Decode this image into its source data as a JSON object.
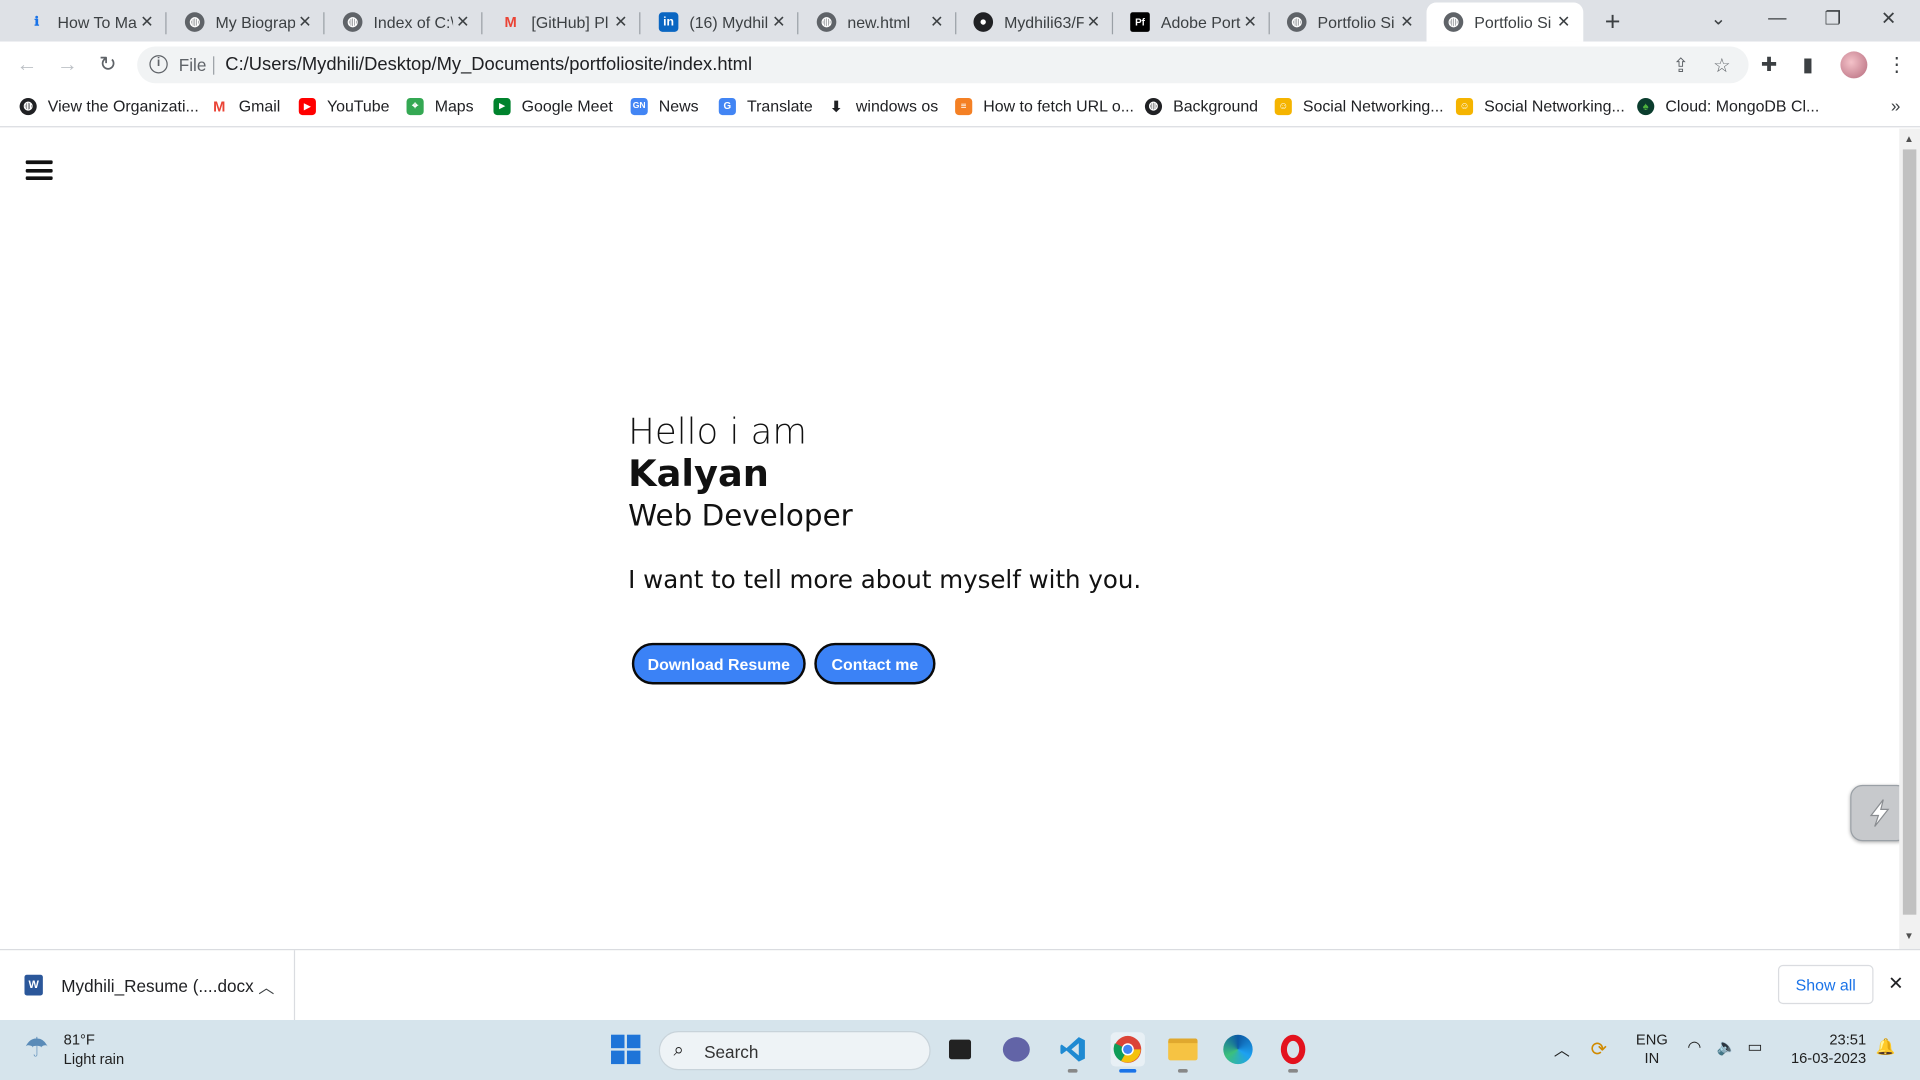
{
  "browser": {
    "tabs": [
      {
        "title": "How To Ma",
        "favicon": "info-icon",
        "active": false
      },
      {
        "title": "My Biograp",
        "favicon": "globe-icon",
        "active": false
      },
      {
        "title": "Index of C:\\",
        "favicon": "globe-icon",
        "active": false
      },
      {
        "title": "[GitHub] Pl",
        "favicon": "gmail-icon",
        "active": false
      },
      {
        "title": "(16) Mydhil",
        "favicon": "linkedin-icon",
        "active": false
      },
      {
        "title": "new.html",
        "favicon": "globe-icon",
        "active": false
      },
      {
        "title": "Mydhili63/F",
        "favicon": "github-icon",
        "active": false
      },
      {
        "title": "Adobe Port",
        "favicon": "adobe-portfolio-icon",
        "active": false
      },
      {
        "title": "Portfolio Si",
        "favicon": "globe-icon",
        "active": false
      },
      {
        "title": "Portfolio Si",
        "favicon": "globe-icon",
        "active": true
      }
    ],
    "address": {
      "scheme_label": "File",
      "url": "C:/Users/Mydhili/Desktop/My_Documents/portfoliosite/index.html"
    },
    "bookmarks": [
      {
        "label": "View the Organizati...",
        "icon": "globe-icon"
      },
      {
        "label": "Gmail",
        "icon": "gmail-icon"
      },
      {
        "label": "YouTube",
        "icon": "youtube-icon"
      },
      {
        "label": "Maps",
        "icon": "maps-icon"
      },
      {
        "label": "Google Meet",
        "icon": "meet-icon"
      },
      {
        "label": "News",
        "icon": "news-icon"
      },
      {
        "label": "Translate",
        "icon": "translate-icon"
      },
      {
        "label": "windows os",
        "icon": "download-icon"
      },
      {
        "label": "How to fetch URL o...",
        "icon": "stackoverflow-icon"
      },
      {
        "label": "Background",
        "icon": "globe-icon"
      },
      {
        "label": "Social Networking...",
        "icon": "social-icon"
      },
      {
        "label": "Social Networking...",
        "icon": "social-icon"
      },
      {
        "label": "Cloud: MongoDB Cl...",
        "icon": "mongodb-icon"
      }
    ],
    "bookmarks_more": "»"
  },
  "page": {
    "greeting": "Hello i am",
    "name": "Kalyan",
    "role": "Web Developer",
    "tagline": "I want to tell more about myself with you.",
    "buttons": {
      "download": "Download Resume",
      "contact": "Contact me"
    },
    "accent_color": "#3b82f6"
  },
  "downloads": {
    "file": "Mydhili_Resume (....docx",
    "show_all": "Show all"
  },
  "taskbar": {
    "weather": {
      "temp": "81°F",
      "desc": "Light rain"
    },
    "search_placeholder": "Search",
    "lang": {
      "line1": "ENG",
      "line2": "IN"
    },
    "time": "23:51",
    "date": "16-03-2023"
  }
}
